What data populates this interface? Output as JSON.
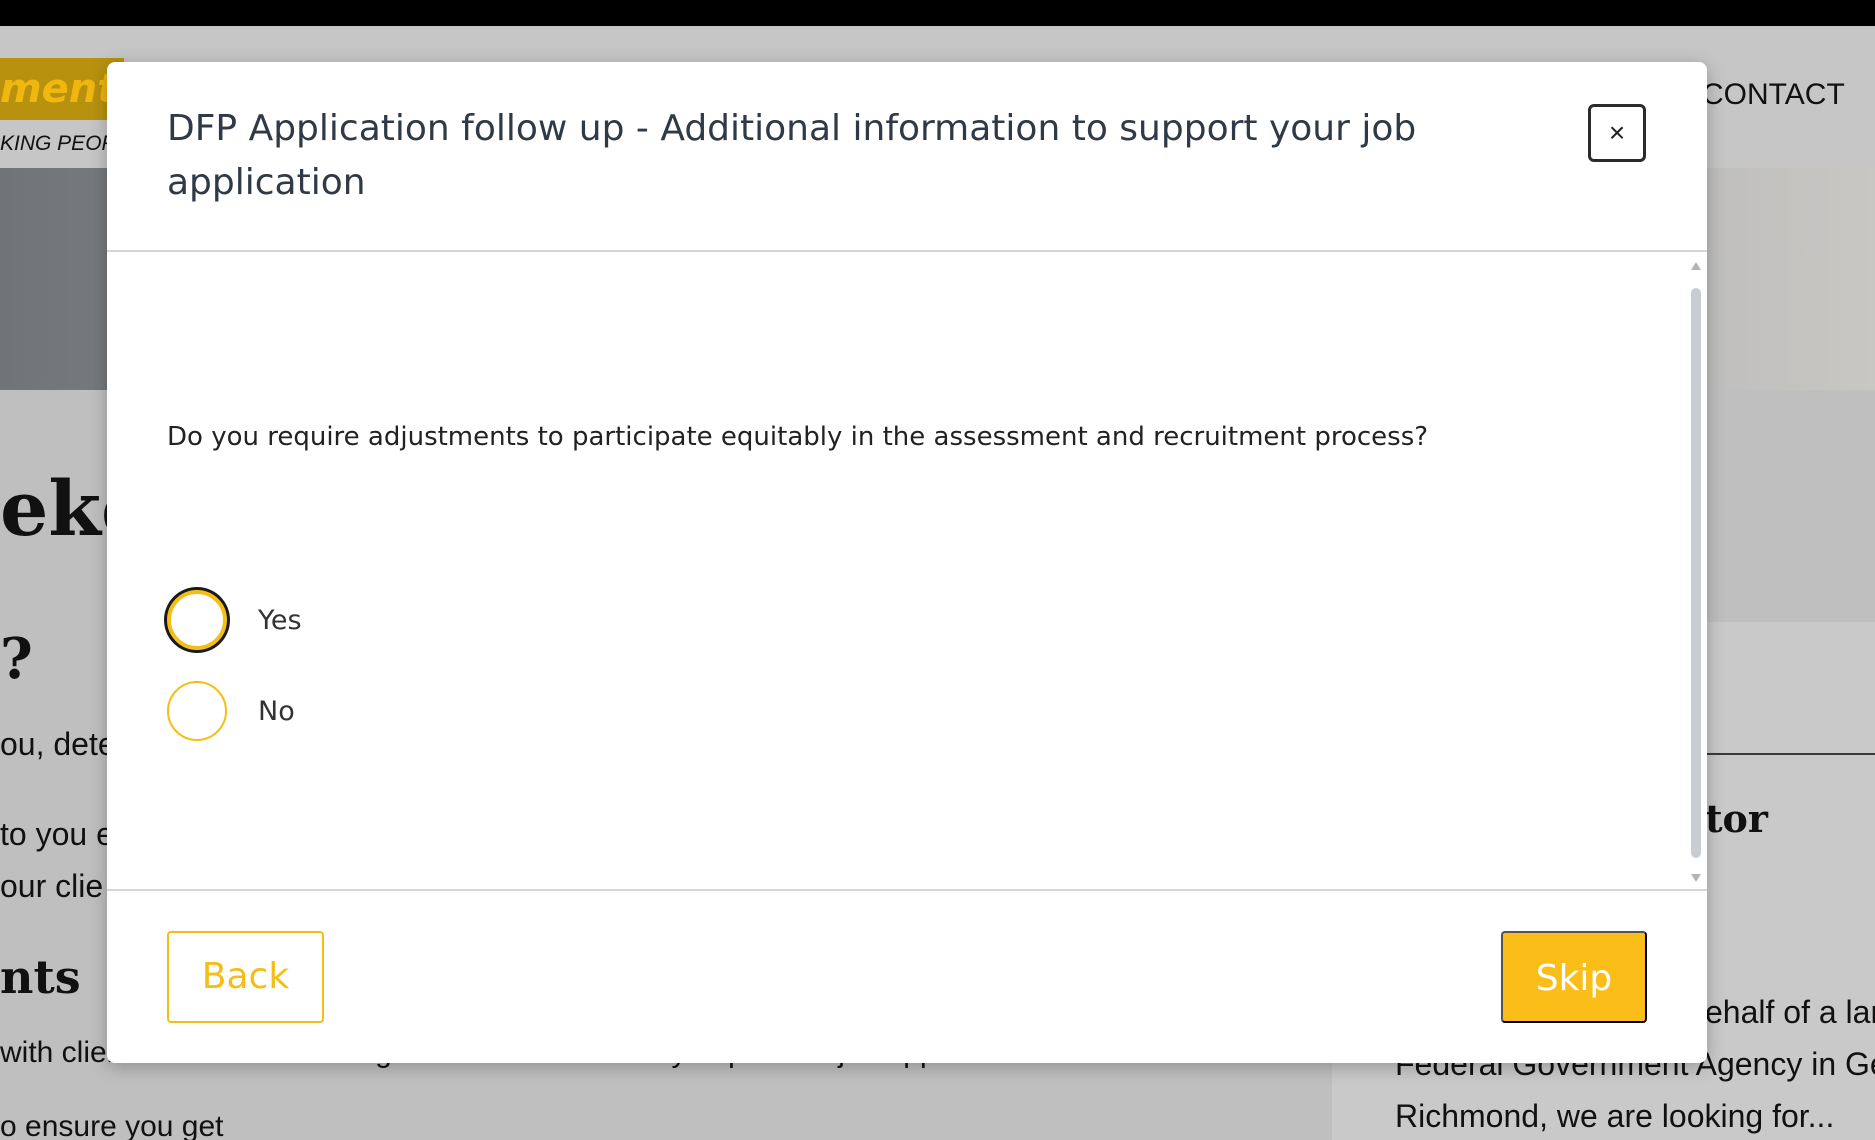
{
  "background": {
    "logo_text": "ment",
    "logo_tagline": "KING PEOPL",
    "nav_contact": "CONTACT",
    "heading_fragment": "eke",
    "question_fragment": "?",
    "line_1": "ou, dete",
    "line_2": "to you e",
    "line_3": "our clie",
    "subheading_fragment": "nts",
    "line_4": "with clients whose values align with ours and offer you positive job opportunities.",
    "line_5": "o ensure you get",
    "side_title_fragment": "tor",
    "side_line_1": "ehalf of a lar",
    "side_line_2": "Federal Government Agency in Ge",
    "side_line_3": "Richmond, we are looking for..."
  },
  "modal": {
    "title": "DFP Application follow up - Additional information to support your job application",
    "close_label": "×",
    "question": "Do you require adjustments to participate equitably in the assessment and recruitment process?",
    "options": [
      {
        "label": "Yes",
        "selected": false,
        "focused": true
      },
      {
        "label": "No",
        "selected": false,
        "focused": false
      }
    ],
    "back_label": "Back",
    "skip_label": "Skip"
  },
  "colors": {
    "accent": "#fbbd18",
    "title_text": "#2f3a46",
    "overlay": "#bfbfbf"
  }
}
